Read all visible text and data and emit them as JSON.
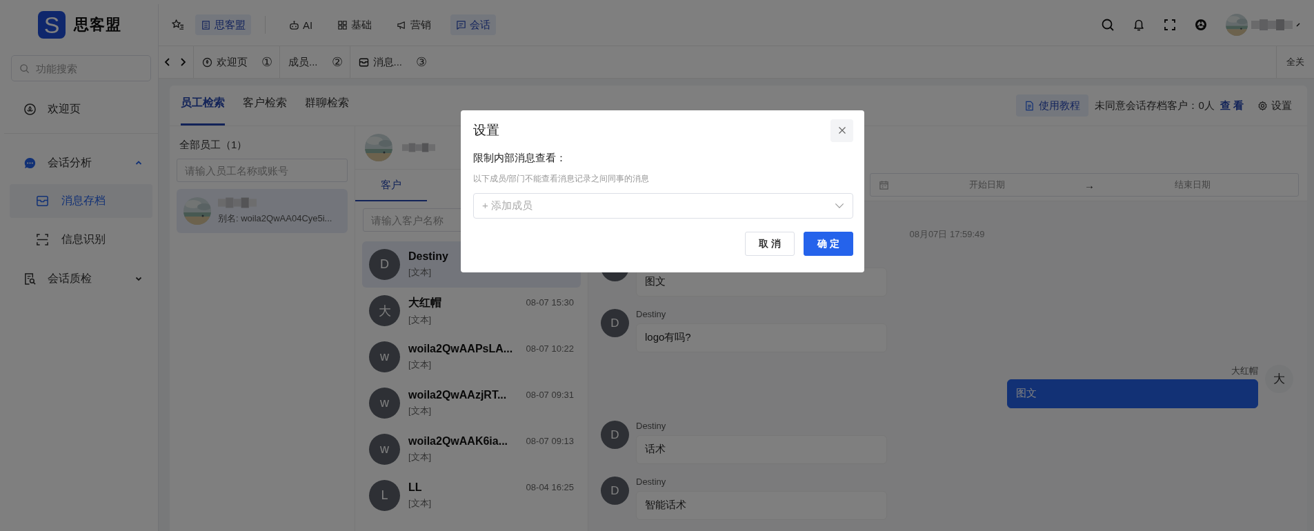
{
  "brand": {
    "logo_mark": "S",
    "name": "思客盟"
  },
  "sidebar": {
    "search": {
      "placeholder": "功能搜索"
    },
    "items": [
      {
        "label": "欢迎页",
        "selected": false
      },
      {
        "label": "会话分析",
        "selected": false,
        "expanded": true,
        "children": [
          {
            "label": "消息存档",
            "selected": true
          },
          {
            "label": "信息识别",
            "selected": false
          }
        ]
      },
      {
        "label": "会话质检",
        "selected": false,
        "expanded": false
      }
    ]
  },
  "topnav": [
    {
      "label": "思客盟",
      "selected": true
    },
    {
      "label": "AI",
      "selected": false
    },
    {
      "label": "基础",
      "selected": false
    },
    {
      "label": "营销",
      "selected": false
    },
    {
      "label": "会话",
      "selected": true
    }
  ],
  "page_tabs": {
    "tabs": [
      {
        "label": "欢迎页",
        "badge": "①"
      },
      {
        "label": "成员...",
        "badge": "②"
      },
      {
        "label": "消息...",
        "badge": "③"
      }
    ],
    "close_all": "全关"
  },
  "content": {
    "search_tabs": [
      {
        "label": "员工检索",
        "selected": true
      },
      {
        "label": "客户检索",
        "selected": false
      },
      {
        "label": "群聊检索",
        "selected": false
      }
    ],
    "tutorial_button": "使用教程",
    "consent_text": "未同意会话存档客户：0人",
    "view_link": "查 看",
    "settings_link": "设置"
  },
  "employees": {
    "heading": "全部员工（1）",
    "search_placeholder": "请输入员工名称或账号",
    "items": [
      {
        "alias": "别名: woila2QwAA04Cye5i...",
        "selected": true
      }
    ]
  },
  "customers": {
    "tabs": [
      {
        "label": "客户",
        "selected": true
      }
    ],
    "search_placeholder": "请输入客户名称",
    "items": [
      {
        "initial": "D",
        "name": "Destiny",
        "preview": "[文本]",
        "selected": true
      },
      {
        "initial": "大",
        "name": "大红帽",
        "preview": "[文本]",
        "time": "08-07 15:30",
        "selected": false
      },
      {
        "initial": "w",
        "name": "woila2QwAAPsLA...",
        "preview": "[文本]",
        "time": "08-07 10:22",
        "selected": false
      },
      {
        "initial": "w",
        "name": "woila2QwAAzjRT...",
        "preview": "[文本]",
        "time": "08-07 09:31",
        "selected": false
      },
      {
        "initial": "w",
        "name": "woila2QwAAK6ia...",
        "preview": "[文本]",
        "time": "08-07 09:13",
        "selected": false
      },
      {
        "initial": "L",
        "name": "LL",
        "preview": "[文本]",
        "time": "08-04 16:25",
        "selected": false
      }
    ]
  },
  "chat": {
    "date_range": {
      "start_placeholder": "开始日期",
      "separator": "→",
      "end_placeholder": "结束日期"
    },
    "timestamp": "08月07日 17:59:49",
    "messages": [
      {
        "kind": "received",
        "text": "图文"
      },
      {
        "kind": "received",
        "sender": "Destiny",
        "initial": "D",
        "text": "logo有吗?"
      },
      {
        "kind": "sent",
        "sender": "大红帽",
        "initial": "大",
        "text": "图文"
      },
      {
        "kind": "received",
        "sender": "Destiny",
        "initial": "D",
        "text": "话术"
      },
      {
        "kind": "received",
        "sender": "Destiny",
        "initial": "D",
        "text": "智能话术"
      }
    ]
  },
  "modal": {
    "title": "设置",
    "label": "限制内部消息查看：",
    "hint": "以下成员/部门不能查看消息记录之间同事的消息",
    "select_placeholder": "+ 添加成员",
    "buttons": [
      {
        "label": "取 消",
        "kind": "default"
      },
      {
        "label": "确 定",
        "kind": "primary"
      }
    ]
  }
}
